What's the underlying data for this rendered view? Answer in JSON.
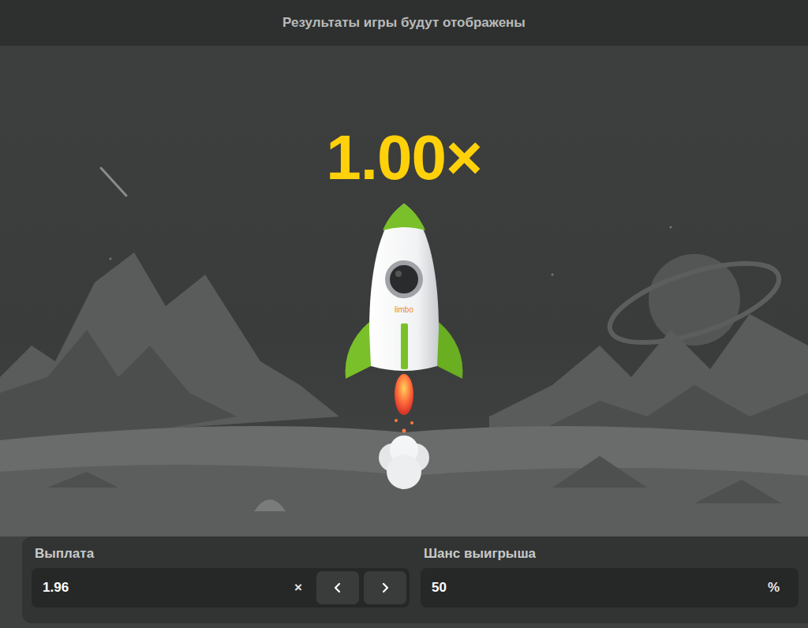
{
  "top_bar": {
    "text": "Результаты игры будут отображены"
  },
  "multiplier": "1.00×",
  "rocket": {
    "label": "limbo"
  },
  "controls": [
    {
      "label": "Выплата",
      "value": "1.96",
      "suffix": "×",
      "kind": "stepper"
    },
    {
      "label": "Шанс выигрыша",
      "value": "50",
      "suffix": "%",
      "kind": "plain"
    }
  ]
}
